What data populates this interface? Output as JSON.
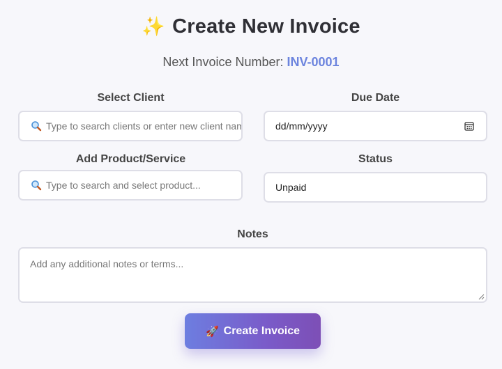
{
  "header": {
    "title": "Create New Invoice",
    "title_icon": "sparkles-icon",
    "next_label": "Next Invoice Number:",
    "next_value": "INV-0001"
  },
  "form": {
    "client": {
      "label": "Select Client",
      "placeholder": "Type to search clients or enter new client name"
    },
    "due_date": {
      "label": "Due Date",
      "value": "dd/mm/yyyy"
    },
    "product": {
      "label": "Add Product/Service",
      "placeholder": "Type to search and select product..."
    },
    "status": {
      "label": "Status",
      "value": "Unpaid"
    },
    "notes": {
      "label": "Notes",
      "placeholder": "Add any additional notes or terms..."
    },
    "submit": {
      "label": "Create Invoice",
      "icon": "rocket-icon"
    }
  },
  "colors": {
    "accent": "#6c84de",
    "button_start": "#6d7ee0",
    "button_end": "#7d4fb6",
    "border": "#dedee7"
  }
}
